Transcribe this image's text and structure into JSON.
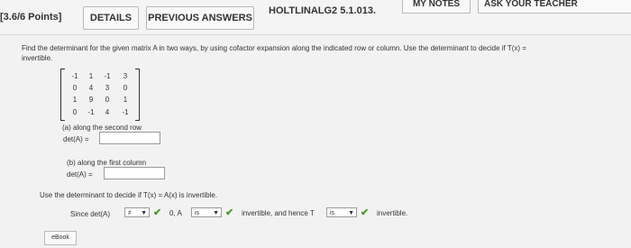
{
  "header": {
    "points": "[3.6/6 Points]",
    "details_label": "DETAILS",
    "previous_answers_label": "PREVIOUS ANSWERS",
    "problem_id": "HOLTLINALG2 5.1.013.",
    "my_notes_label": "MY NOTES",
    "ask_label": "ASK YOUR TEACHER"
  },
  "prompt": {
    "line1": "Find the determinant for the given matrix A in two ways, by using cofactor expansion along the indicated row or column. Use the determinant to decide if T(x) =",
    "line2": "invertible."
  },
  "matrix": {
    "rows": [
      [
        "-1",
        "1",
        "-1",
        "3"
      ],
      [
        "0",
        "4",
        "3",
        "0"
      ],
      [
        "1",
        "9",
        "0",
        "1"
      ],
      [
        "0",
        "-1",
        "4",
        "-1"
      ]
    ]
  },
  "part_a": {
    "label": "(a) along the second row",
    "det_label": "det(A) =",
    "value": ""
  },
  "part_b": {
    "label": "(b) along the first column",
    "det_label": "det(A) =",
    "value": ""
  },
  "decision": {
    "text": "Use the determinant to decide if T(x) = A(x) is invertible.",
    "since_prefix": "Since det(A)",
    "select1_value": "≠",
    "mid_text": "0, A",
    "select2_value": "is",
    "invertible_text": "invertible, and hence T",
    "select3_value": "is",
    "tail_text": "invertible."
  },
  "ebook_label": "eBook"
}
